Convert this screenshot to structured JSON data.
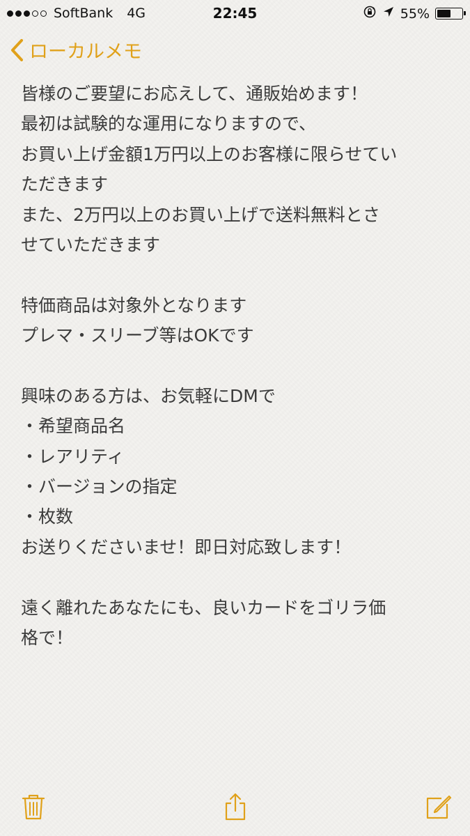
{
  "status_bar": {
    "carrier": "SoftBank",
    "network": "4G",
    "time": "22:45",
    "battery_percent": "55%",
    "battery_level": 0.55,
    "signal_bars_filled": 3,
    "signal_bars_total": 5
  },
  "nav": {
    "back_label": "ローカルメモ"
  },
  "note": {
    "lines": [
      "皆様のご要望にお応えして、通販始めます！",
      "最初は試験的な運用になりますので、",
      "お買い上げ金額1万円以上のお客様に限らせてい",
      "ただきます",
      "また、2万円以上のお買い上げで送料無料とさ",
      "せていただきます",
      "",
      "特価商品は対象外となります",
      "プレマ・スリーブ等はOKです",
      "",
      "興味のある方は、お気軽にDMで",
      "・希望商品名",
      "・レアリティ",
      "・バージョンの指定",
      "・枚数",
      "お送りくださいませ！即日対応致します！",
      "",
      "遠く離れたあなたにも、良いカードをゴリラ価",
      "格で！"
    ]
  },
  "colors": {
    "accent": "#e0a11a",
    "text": "#3b3b3b",
    "background": "#f3f2ef"
  },
  "toolbar": {
    "icons": [
      "trash-icon",
      "share-icon",
      "compose-icon"
    ]
  }
}
